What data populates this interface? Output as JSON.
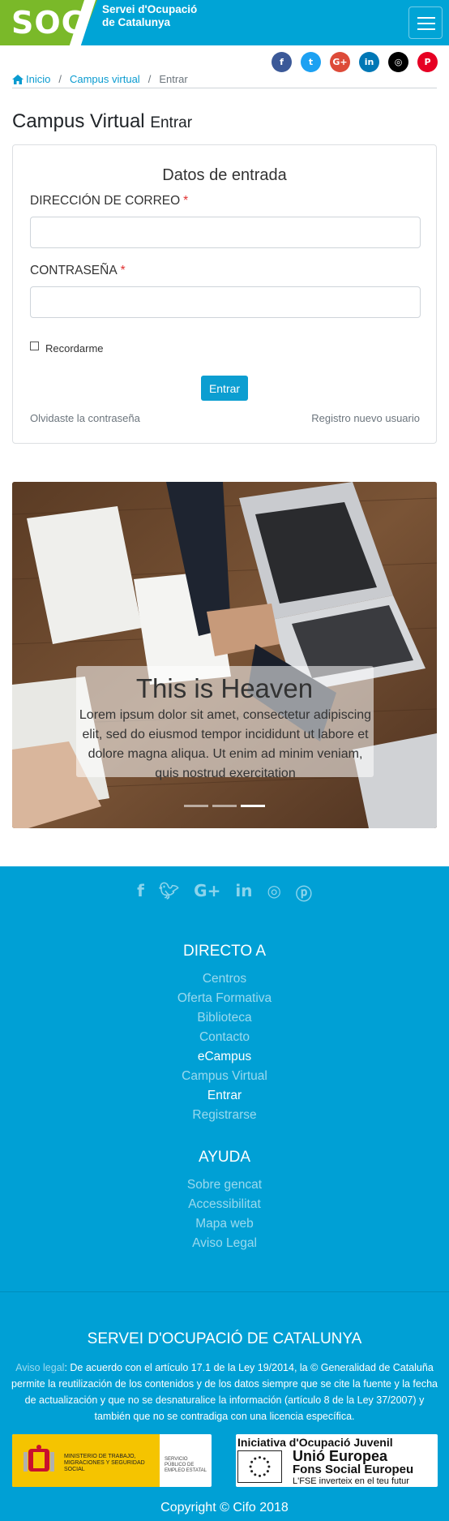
{
  "header": {
    "logo_text": "SOC",
    "org_line1": "Servei d'Ocupació",
    "org_line2": "de Catalunya"
  },
  "social": [
    {
      "icon": "facebook-icon",
      "glyph": "f",
      "color": "#3b5998"
    },
    {
      "icon": "twitter-icon",
      "glyph": "t",
      "color": "#1da1f2"
    },
    {
      "icon": "google-plus-icon",
      "glyph": "G+",
      "color": "#dd4b39"
    },
    {
      "icon": "linkedin-icon",
      "glyph": "in",
      "color": "#0077b5"
    },
    {
      "icon": "instagram-icon",
      "glyph": "◎",
      "color": "#000000"
    },
    {
      "icon": "pinterest-icon",
      "glyph": "P",
      "color": "#e60023"
    }
  ],
  "breadcrumb": {
    "home": "Inicio",
    "campus": "Campus virtual",
    "current": "Entrar"
  },
  "page": {
    "title": "Campus Virtual",
    "subtitle": "Entrar"
  },
  "login": {
    "heading": "Datos de entrada",
    "email_label": "Dirección de correo",
    "password_label": "Contraseña",
    "required_mark": "*",
    "email_value": "",
    "password_value": "",
    "remember_label": "Recordarme",
    "submit_label": "Entrar",
    "forgot_label": "Olvidaste la contraseña",
    "register_label": "Registro nuevo usuario"
  },
  "carousel": {
    "caption_title": "This is Heaven",
    "caption_text": "Lorem ipsum dolor sit amet, consectetur adipiscing elit, sed do eiusmod tempor incididunt ut labore et dolore magna aliqua. Ut enim ad minim veniam, quis nostrud exercitation",
    "active_slide": 3,
    "slide_count": 3
  },
  "footer": {
    "directo_heading": "DIRECTO A",
    "directo_links": [
      "Centros",
      "Oferta Formativa",
      "Biblioteca",
      "Contacto",
      "eCampus",
      "Campus Virtual",
      "Entrar",
      "Registrarse"
    ],
    "ayuda_heading": "AYUDA",
    "ayuda_links": [
      "Sobre gencat",
      "Accessibilitat",
      "Mapa web",
      "Aviso Legal"
    ],
    "org_heading": "SERVEI D'OCUPACIÓ DE CATALUNYA",
    "aviso_label": "Aviso legal",
    "legal_text": ": De acuerdo con el artículo 17.1 de la Ley 19/2014, la © Generalidad de Cataluña permite la reutilización de los contenidos y de los datos siempre que se cite la fuente y la fecha de actualización y que no se desnaturalice la información (artículo 8 de la Ley 37/2007) y también que no se contradiga con una licencia específica.",
    "ministry_text": "MINISTERIO DE TRABAJO, MIGRACIONES Y SEGURIDAD SOCIAL",
    "sepe_text": "SERVICIO PÚBLICO DE EMPLEO ESTATAL",
    "eu_line1": "Iniciativa d'Ocupació Juvenil",
    "eu_line2": "Unió Europea",
    "eu_line3": "Fons Social Europeu",
    "eu_line4": "L'FSE inverteix en el teu futur",
    "copyright": "Copyright © Cifo 2018"
  },
  "colors": {
    "brand_blue": "#00a0d5",
    "brand_green": "#7ab929",
    "button_blue": "#0c9ed1",
    "required_red": "#e03131"
  }
}
